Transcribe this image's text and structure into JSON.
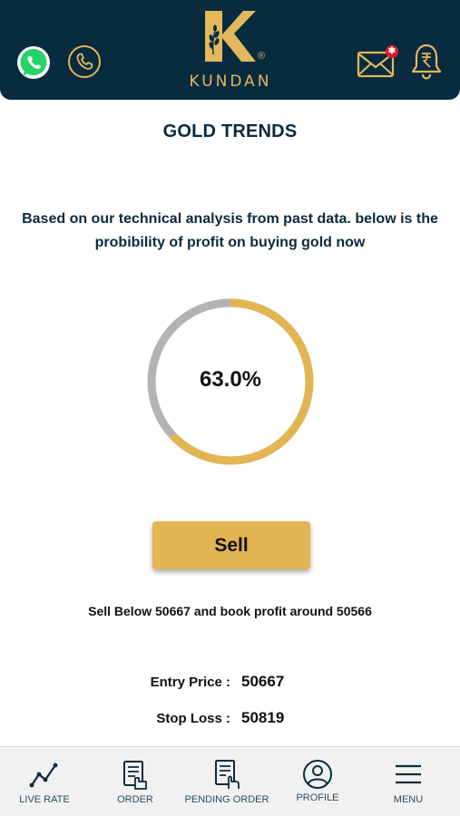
{
  "header": {
    "brand": "KUNDAN",
    "logo_letter": "K",
    "registered_mark": "®",
    "mail_badge": "✱",
    "whatsapp_icon": "whatsapp-icon",
    "phone_icon": "phone-icon",
    "mail_icon": "mail-icon",
    "bell_icon": "rupee-bell-icon",
    "colors": {
      "background": "#082b40",
      "gold": "#e2b85a",
      "badge": "#e11a2a"
    }
  },
  "page": {
    "title": "GOLD TRENDS",
    "description": "Based on our technical analysis from past data. below is the probibility of profit on buying gold now"
  },
  "gauge": {
    "value_label": "63.0%",
    "fraction": 0.63,
    "colors": {
      "filled": "#e2b552",
      "remaining": "#b3b3b3"
    }
  },
  "action": {
    "button_label": "Sell",
    "advice": "Sell Below 50667 and book profit around 50566",
    "entry_label": "Entry Price :",
    "entry_value": "50667",
    "stop_label": "Stop Loss :",
    "stop_value": "50819"
  },
  "bottom_nav": {
    "items": [
      {
        "label": "LIVE RATE",
        "icon": "chart-line-icon"
      },
      {
        "label": "ORDER",
        "icon": "order-clipboard-icon"
      },
      {
        "label": "PENDING ORDER",
        "icon": "pending-order-icon"
      },
      {
        "label": "PROFILE",
        "icon": "profile-icon"
      },
      {
        "label": "MENU",
        "icon": "menu-icon"
      }
    ]
  }
}
